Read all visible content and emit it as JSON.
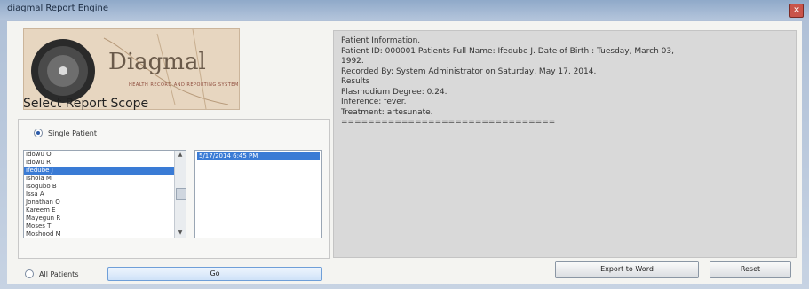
{
  "window": {
    "title": "diagmal Report Engine",
    "close_glyph": "✕"
  },
  "logo": {
    "word": "Diagmal",
    "tagline": "HEALTH RECORD AND REPORTING SYSTEM"
  },
  "scope": {
    "label": "Select Report Scope",
    "single_patient_label": "Single Patient",
    "all_patients_label": "All Patients",
    "selected_scope": "Single Patient"
  },
  "patients": {
    "items": [
      "Idowu O",
      "Idowu R",
      "Ifedube J",
      "Ishola M",
      "Isogubo B",
      "Issa A",
      "Jonathan O",
      "Kareem E",
      "Mayegun R",
      "Moses T",
      "Moshood M"
    ],
    "selected": "Ifedube J"
  },
  "dates": {
    "items": [
      "5/17/2014 6:45 PM"
    ],
    "selected": "5/17/2014 6:45 PM"
  },
  "go_label": "Go",
  "report": {
    "lines": [
      "Patient Information.",
      "Patient ID: 000001 Patients Full Name: Ifedube J. Date of Birth : Tuesday, March 03,",
      "1992.",
      "Recorded By: System Administrator on Saturday, May 17, 2014.",
      "Results",
      "Plasmodium Degree: 0.24.",
      "Inference: fever.",
      "Treatment: artesunate.",
      "================================"
    ]
  },
  "buttons": {
    "export_label": "Export to Word",
    "reset_label": "Reset"
  },
  "icons": {
    "close": "close-icon",
    "scroll_up": "chevron-up-icon",
    "scroll_down": "chevron-down-icon"
  },
  "colors": {
    "selection": "#3a7bd5",
    "report_bg": "#d9d9d9",
    "title_bar": "#8fa9c9"
  }
}
